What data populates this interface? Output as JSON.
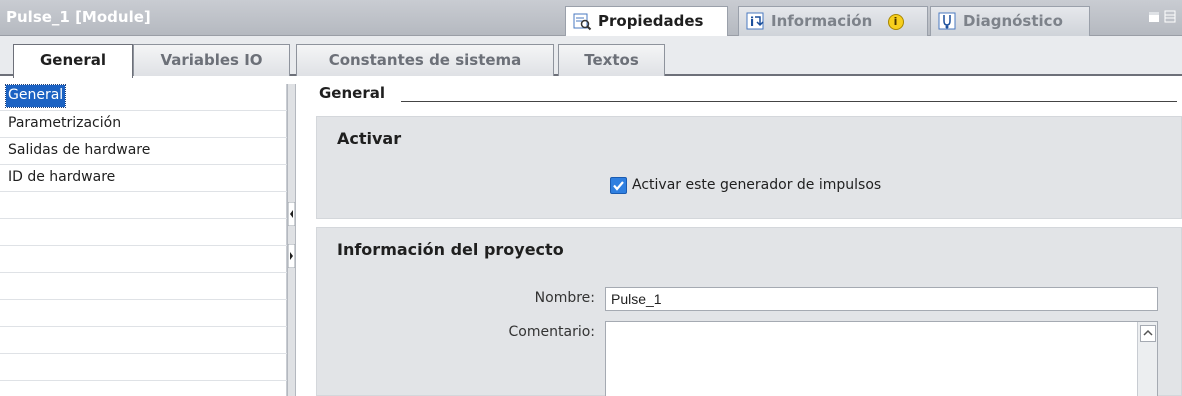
{
  "window": {
    "title": "Pulse_1 [Module]",
    "tabs": [
      {
        "label": "Propiedades",
        "active": true,
        "icon": "properties-icon"
      },
      {
        "label": "Información",
        "active": false,
        "icon": "info-tab-icon",
        "badge": "i"
      },
      {
        "label": "Diagnóstico",
        "active": false,
        "icon": "diagnostics-icon"
      }
    ]
  },
  "main_tabs": [
    "General",
    "Variables IO",
    "Constantes de sistema",
    "Textos"
  ],
  "nav": {
    "items": [
      "General",
      "Parametrización",
      "Salidas de hardware",
      "ID de hardware"
    ],
    "selected": "General"
  },
  "content": {
    "heading": "General",
    "activar": {
      "title": "Activar",
      "checkbox_label": "Activar este generador de impulsos",
      "checked": true
    },
    "project_info": {
      "title": "Información del proyecto",
      "name_label": "Nombre:",
      "name_value": "Pulse_1",
      "comment_label": "Comentario:",
      "comment_value": ""
    }
  },
  "colors": {
    "selection": "#1b62c3",
    "group_bg": "#e2e4e7",
    "title_bar": "#b5b9c0"
  }
}
